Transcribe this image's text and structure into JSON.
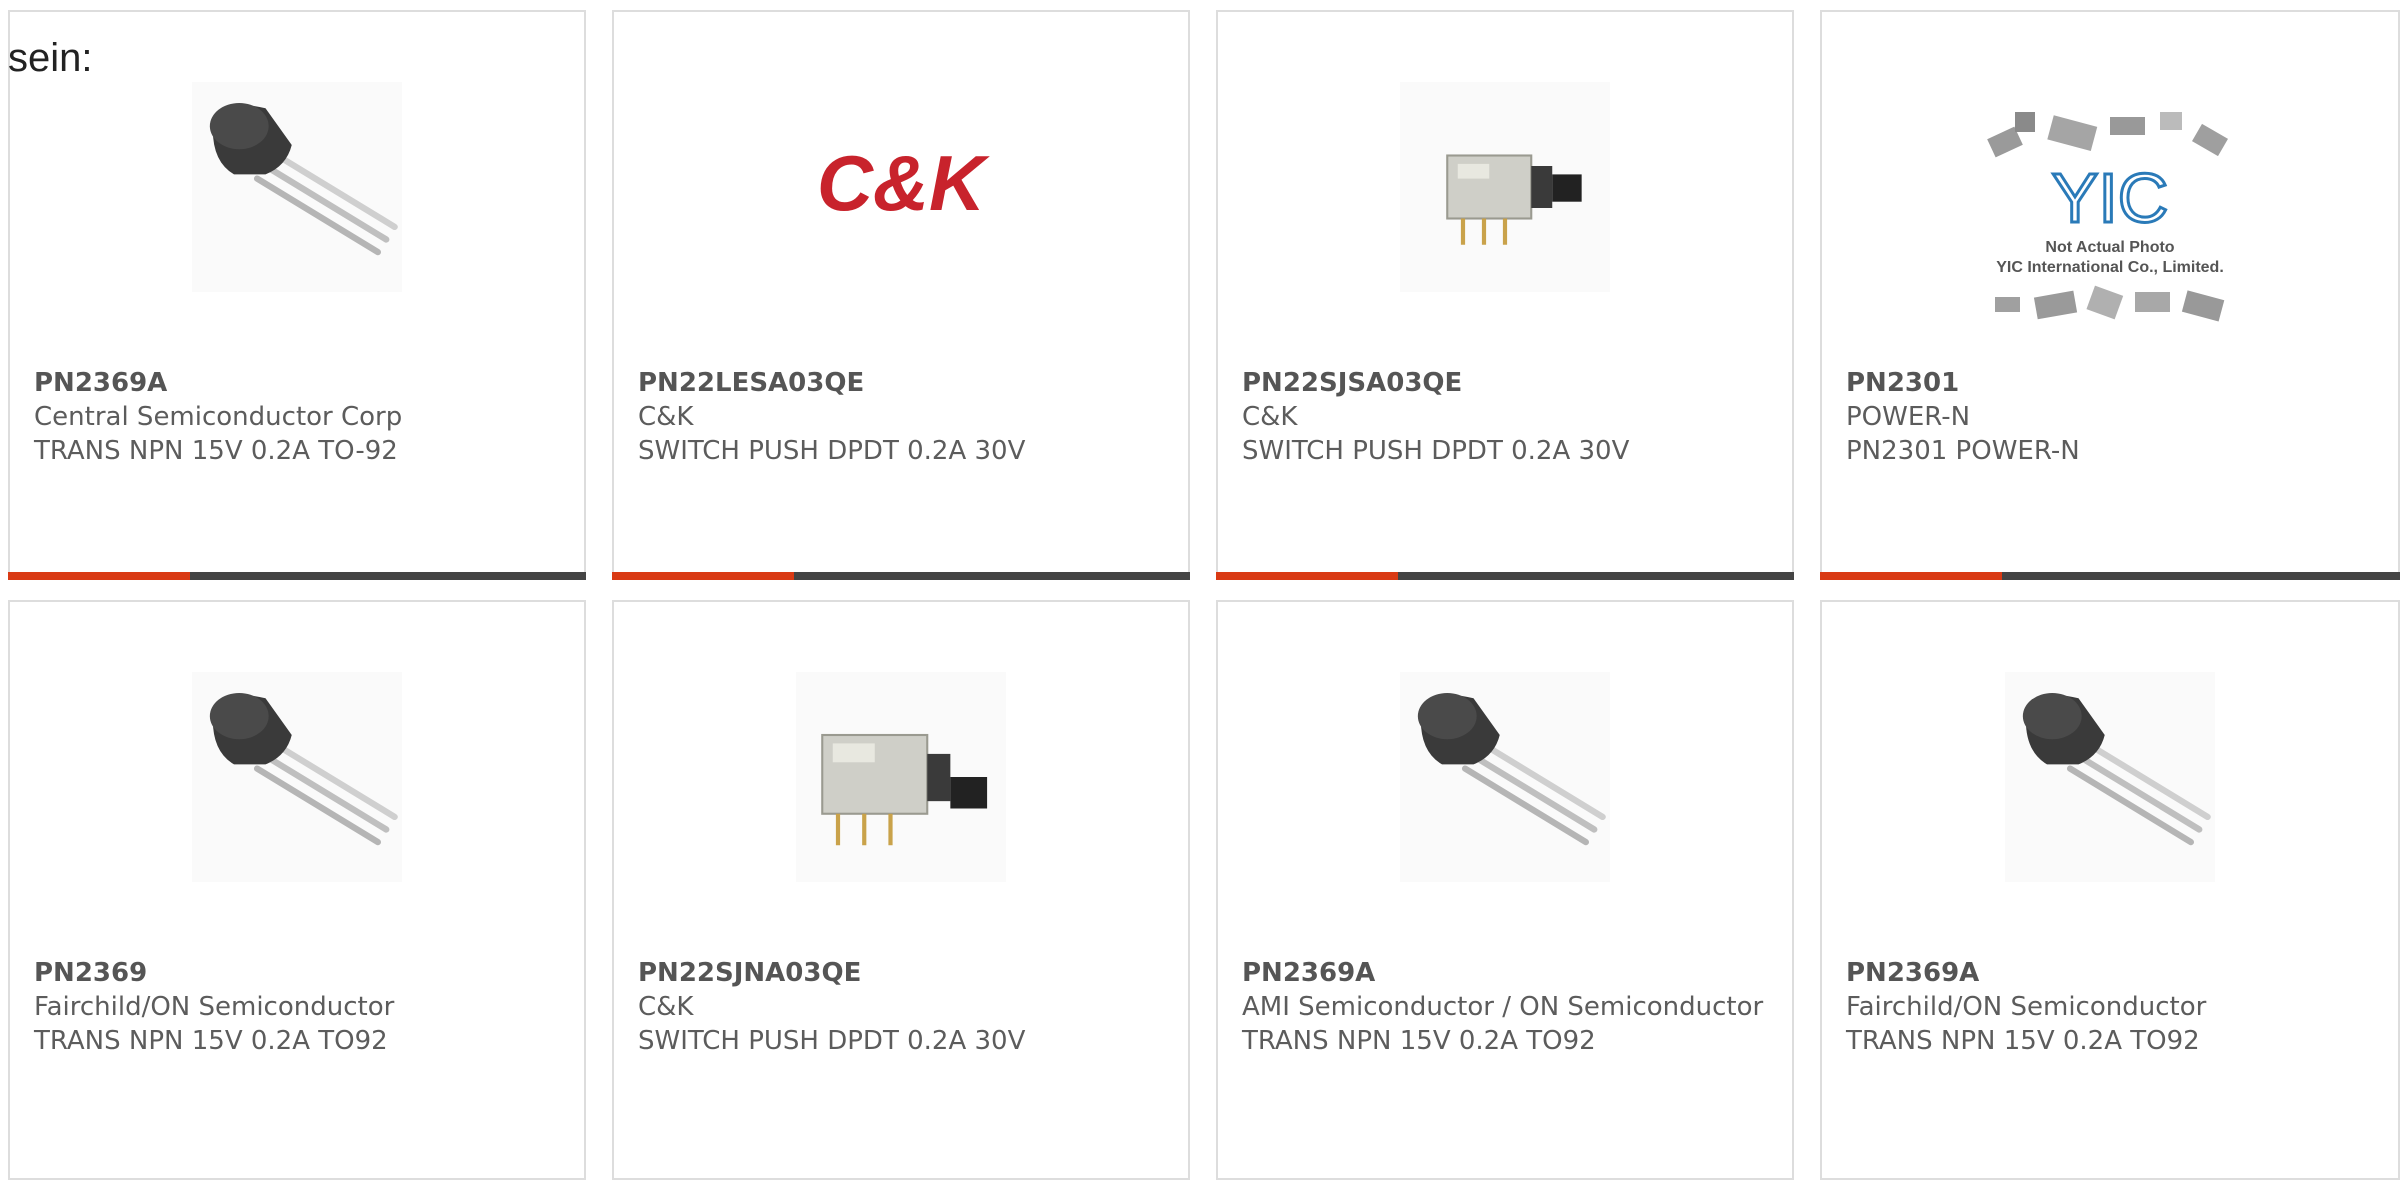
{
  "intro_text": "sein:",
  "colors": {
    "accent": "#d93a14",
    "bar": "#444444",
    "border": "#dddddd",
    "text": "#5c5c5c"
  },
  "products": [
    {
      "part_number": "PN2369A",
      "manufacturer": "Central Semiconductor Corp",
      "description": "TRANS NPN 15V 0.2A TO-92",
      "image": "to92-transistor-icon"
    },
    {
      "part_number": "PN22LESA03QE",
      "manufacturer": "C&K",
      "description": "SWITCH PUSH DPDT 0.2A 30V",
      "image": "ck-logo",
      "logo_text": "C&K"
    },
    {
      "part_number": "PN22SJSA03QE",
      "manufacturer": "C&K",
      "description": "SWITCH PUSH DPDT 0.2A 30V",
      "image": "push-switch-icon"
    },
    {
      "part_number": "PN2301",
      "manufacturer": "POWER-N",
      "description": "PN2301 POWER-N",
      "image": "yic-placeholder",
      "logo_text": "YIC",
      "placeholder_line1": "Not Actual Photo",
      "placeholder_line2": "YIC International Co., Limited."
    },
    {
      "part_number": "PN2369",
      "manufacturer": "Fairchild/ON Semiconductor",
      "description": "TRANS NPN 15V 0.2A TO92",
      "image": "to92-transistor-icon"
    },
    {
      "part_number": "PN22SJNA03QE",
      "manufacturer": "C&K",
      "description": "SWITCH PUSH DPDT 0.2A 30V",
      "image": "push-switch-icon"
    },
    {
      "part_number": "PN2369A",
      "manufacturer": "AMI Semiconductor / ON Semiconductor",
      "description": "TRANS NPN 15V 0.2A TO92",
      "image": "to92-transistor-icon"
    },
    {
      "part_number": "PN2369A",
      "manufacturer": "Fairchild/ON Semiconductor",
      "description": "TRANS NPN 15V 0.2A TO92",
      "image": "to92-transistor-icon"
    }
  ]
}
